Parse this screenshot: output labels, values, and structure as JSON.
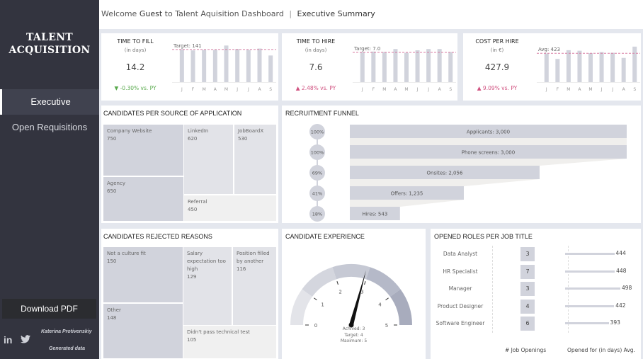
{
  "sidebar": {
    "logo_line1": "TALENT",
    "logo_line2": "ACQUISITION",
    "nav": [
      {
        "label": "Executive",
        "active": true
      },
      {
        "label": "Open Requisitions",
        "active": false
      }
    ],
    "download_label": "Download PDF",
    "social_linkedin": "in",
    "social_twitter": "🐦",
    "credit_author": "Katerina Protivenskiy",
    "credit_note": "Generated data"
  },
  "header": {
    "welcome": "Welcome",
    "guest": "Guest",
    "to": "to",
    "app_name": "Talent Aquisition Dashboard",
    "separator": "|",
    "page": "Executive Summary"
  },
  "kpis": [
    {
      "title": "TIME TO FILL",
      "unit": "(in days)",
      "value": "14.2",
      "delta": "▼ -0.30% vs. PY",
      "delta_color": "#5aaa4e",
      "ref_label": "Target: 141",
      "ref_value": 141,
      "months": [
        "J",
        "F",
        "M",
        "A",
        "M",
        "J",
        "J",
        "A",
        "S"
      ],
      "values": [
        142,
        137,
        139,
        139,
        158,
        143,
        139,
        145,
        115
      ],
      "ymax": 165
    },
    {
      "title": "TIME TO HIRE",
      "unit": "(in days)",
      "value": "7.6",
      "delta": "▲ 2.48% vs. PY",
      "delta_color": "#d0507f",
      "ref_label": "Target: 7.0",
      "ref_value": 7.0,
      "months": [
        "J",
        "F",
        "M",
        "A",
        "M",
        "J",
        "J",
        "A",
        "S"
      ],
      "values": [
        7.1,
        7.2,
        7.1,
        7.8,
        6.9,
        7.5,
        7.8,
        7.8,
        7.1
      ],
      "ymax": 9
    },
    {
      "title": "COST PER HIRE",
      "unit": "(in €)",
      "value": "427.9",
      "delta": "▲ 9.09% vs. PY",
      "delta_color": "#d0507f",
      "ref_label": "Avg: 423",
      "ref_value": 423,
      "months": [
        "J",
        "F",
        "M",
        "A",
        "M",
        "J",
        "J",
        "A",
        "S"
      ],
      "values": [
        420,
        340,
        468,
        460,
        425,
        440,
        430,
        355,
        520
      ],
      "ymax": 560
    }
  ],
  "source": {
    "title": "CANDIDATES PER SOURCE OF APPLICATION",
    "items": [
      {
        "name": "Company Website",
        "value": "750"
      },
      {
        "name": "LinkedIn",
        "value": "620"
      },
      {
        "name": "JobBoardX",
        "value": "530"
      },
      {
        "name": "Agency",
        "value": "650"
      },
      {
        "name": "Referral",
        "value": "450"
      }
    ]
  },
  "funnel": {
    "title": "RECRUITMENT FUNNEL",
    "stages": [
      {
        "label": "Applicants: 3,000",
        "value": 3000,
        "pct": "100%"
      },
      {
        "label": "Phone screens: 3,000",
        "value": 3000,
        "pct": "100%"
      },
      {
        "label": "Onsites: 2,056",
        "value": 2056,
        "pct": "69%"
      },
      {
        "label": "Offers: 1,235",
        "value": 1235,
        "pct": "41%"
      },
      {
        "label": "Hires: 543",
        "value": 543,
        "pct": "18%"
      }
    ]
  },
  "rejected": {
    "title": "CANDIDATES REJECTED REASONS",
    "items": [
      {
        "name": "Not a culture fit",
        "value": "150"
      },
      {
        "name": "Salary expectation too high",
        "value": "129"
      },
      {
        "name": "Position filled by another",
        "value": "116"
      },
      {
        "name": "Other",
        "value": "148"
      },
      {
        "name": "Didn't pass technical test",
        "value": "105"
      }
    ]
  },
  "experience": {
    "title": "CANDIDATE EXPERIENCE",
    "achieved": 3,
    "target": 4,
    "maximum": 5,
    "ticks": [
      "0",
      "1",
      "2",
      "3",
      "4",
      "5"
    ],
    "label_achieved": "Achived: 3",
    "label_target": "Target: 4",
    "label_maximum": "Maximum: 5"
  },
  "roles": {
    "title": "OPENED ROLES PER JOB TITLE",
    "col_openings": "# Job Openings",
    "col_days": "Opened for (in days) Avg.",
    "items": [
      {
        "title": "Data Analyst",
        "openings": "3",
        "days": 444
      },
      {
        "title": "HR Specialist",
        "openings": "7",
        "days": 448
      },
      {
        "title": "Manager",
        "openings": "3",
        "days": 498
      },
      {
        "title": "Product Designer",
        "openings": "4",
        "days": 442
      },
      {
        "title": "Software Engineer",
        "openings": "6",
        "days": 393
      }
    ]
  }
}
